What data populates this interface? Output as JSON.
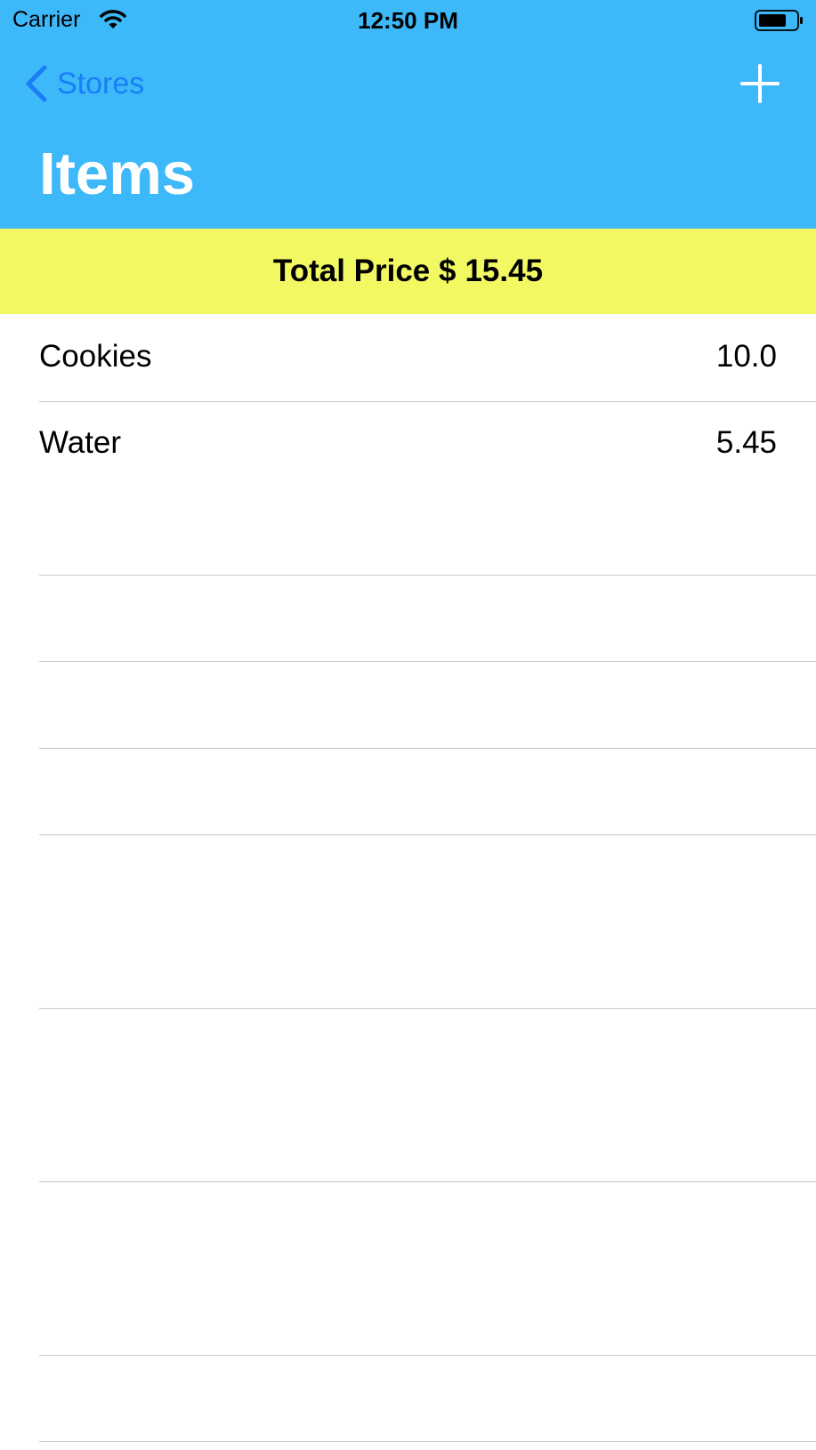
{
  "status_bar": {
    "carrier": "Carrier",
    "time": "12:50 PM"
  },
  "nav": {
    "back_label": "Stores",
    "title": "Items",
    "add_icon": "plus-icon",
    "back_icon": "chevron-left-icon"
  },
  "summary": {
    "total_label": "Total Price $",
    "total_value": "15.45"
  },
  "items": [
    {
      "name": "Cookies",
      "price": "10.0"
    },
    {
      "name": "Water",
      "price": "5.45"
    }
  ],
  "colors": {
    "header_bg": "#3db8f8",
    "banner_bg": "#f2f862",
    "link": "#1a7ef8",
    "separator": "#c8c7cc"
  }
}
